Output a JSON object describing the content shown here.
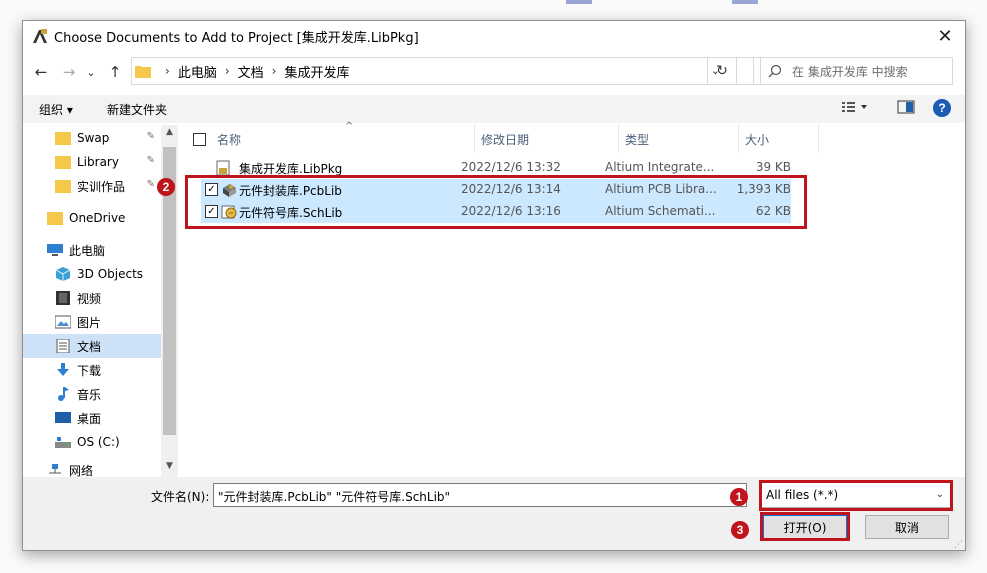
{
  "window": {
    "title": "Choose Documents to Add to Project [集成开发库.LibPkg]",
    "close_glyph": "✕"
  },
  "address": {
    "back_glyph": "←",
    "forward_glyph": "→",
    "recent_glyph": "⌄",
    "up_glyph": "↑",
    "breadcrumb": [
      "此电脑",
      "文档",
      "集成开发库"
    ],
    "separator": "›",
    "dropdown_glyph": "⌄",
    "refresh_glyph": "↻",
    "search_placeholder": "在 集成开发库 中搜索"
  },
  "command_bar": {
    "organize_label": "组织 ▾",
    "new_folder_label": "新建文件夹",
    "help_glyph": "?"
  },
  "nav_pane": {
    "items": [
      {
        "label": "Swap",
        "icon": "folder-icon",
        "pinned": true
      },
      {
        "label": "Library",
        "icon": "folder-icon",
        "pinned": true
      },
      {
        "label": "实训作品",
        "icon": "folder-icon",
        "pinned": true
      },
      {
        "label": "OneDrive",
        "icon": "folder-icon",
        "pinned": false
      },
      {
        "label": "此电脑",
        "icon": "computer-icon",
        "pinned": false
      },
      {
        "label": "3D Objects",
        "icon": "3d-objects-icon",
        "pinned": false
      },
      {
        "label": "视频",
        "icon": "video-icon",
        "pinned": false
      },
      {
        "label": "图片",
        "icon": "pictures-icon",
        "pinned": false
      },
      {
        "label": "文档",
        "icon": "documents-icon",
        "pinned": false,
        "selected": true
      },
      {
        "label": "下载",
        "icon": "download-icon",
        "pinned": false
      },
      {
        "label": "音乐",
        "icon": "music-icon",
        "pinned": false
      },
      {
        "label": "桌面",
        "icon": "desktop-icon",
        "pinned": false
      },
      {
        "label": "OS (C:)",
        "icon": "drive-icon",
        "pinned": false
      },
      {
        "label": "网络",
        "icon": "network-icon",
        "pinned": false
      }
    ],
    "pin_glyph": "📌"
  },
  "file_list": {
    "columns": [
      "名称",
      "修改日期",
      "类型",
      "大小"
    ],
    "sort_glyph": "^",
    "rows": [
      {
        "name": "集成开发库.LibPkg",
        "date": "2022/12/6 13:32",
        "type": "Altium Integrate...",
        "size": "39 KB",
        "selected": false,
        "checked": false
      },
      {
        "name": "元件封装库.PcbLib",
        "date": "2022/12/6 13:14",
        "type": "Altium PCB Libra...",
        "size": "1,393 KB",
        "selected": true,
        "checked": true
      },
      {
        "name": "元件符号库.SchLib",
        "date": "2022/12/6 13:16",
        "type": "Altium Schemati...",
        "size": "62 KB",
        "selected": true,
        "checked": true
      }
    ],
    "check_glyph": "✓"
  },
  "bottom": {
    "filename_label": "文件名(N):",
    "filename_value": "\"元件封装库.PcbLib\" \"元件符号库.SchLib\"",
    "filetype_value": "All files (*.*)",
    "open_label": "打开(O)",
    "cancel_label": "取消"
  },
  "annotations": {
    "badge1": "1",
    "badge2": "2",
    "badge3": "3",
    "color": "#c0141c"
  }
}
